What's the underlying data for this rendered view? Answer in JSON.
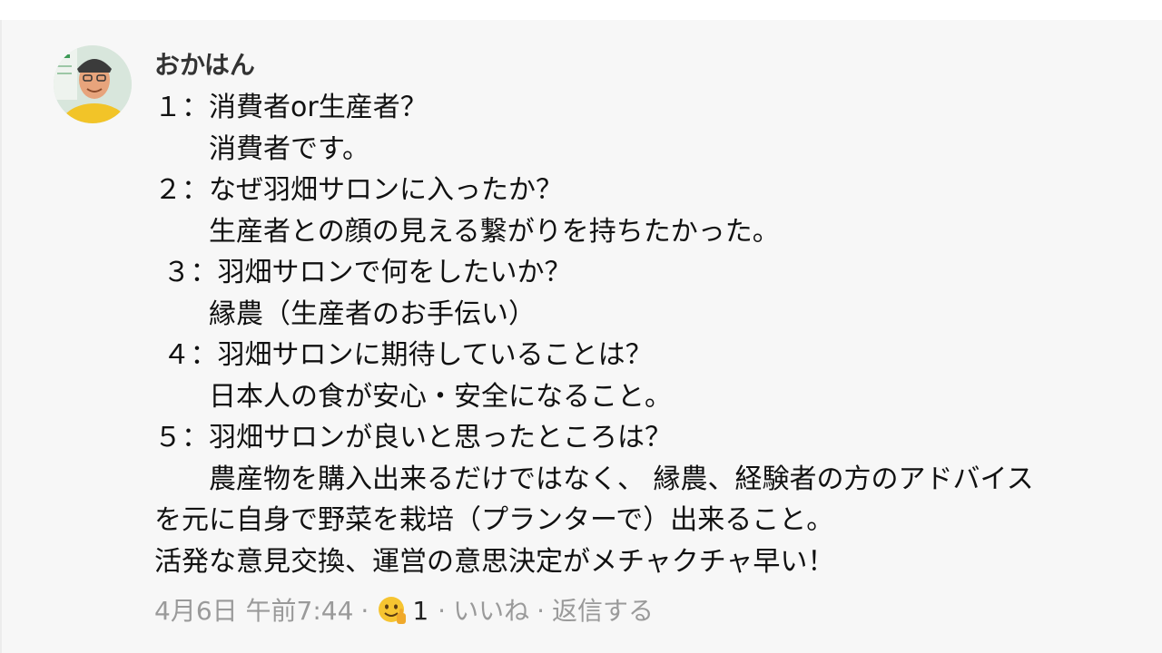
{
  "comment": {
    "author": "おかはん",
    "lines": [
      "１：消費者or生産者？",
      "　　消費者です。",
      "２：なぜ羽畑サロンに入ったか？",
      "　　生産者との顔の見える繋がりを持ちたかった。",
      " ３：羽畑サロンで何をしたいか？",
      "　　縁農（生産者のお手伝い）",
      " ４：羽畑サロンに期待していることは？",
      "　　日本人の食が安心・安全になること。",
      "５：羽畑サロンが良いと思ったところは？",
      "　　農産物を購入出来るだけではなく、 縁農、経験者の方のアドバイス",
      "を元に自身で野菜を栽培（プランターで）出来ること。",
      "活発な意見交換、運営の意思決定がメチャクチャ早い！"
    ],
    "meta": {
      "timestamp": "4月6日 午前7:44",
      "separator": "·",
      "reaction_icon": "thumbs-up-smiley-emoji",
      "reaction_count": "1",
      "like_label": "いいね",
      "reply_label": "返信する"
    }
  }
}
